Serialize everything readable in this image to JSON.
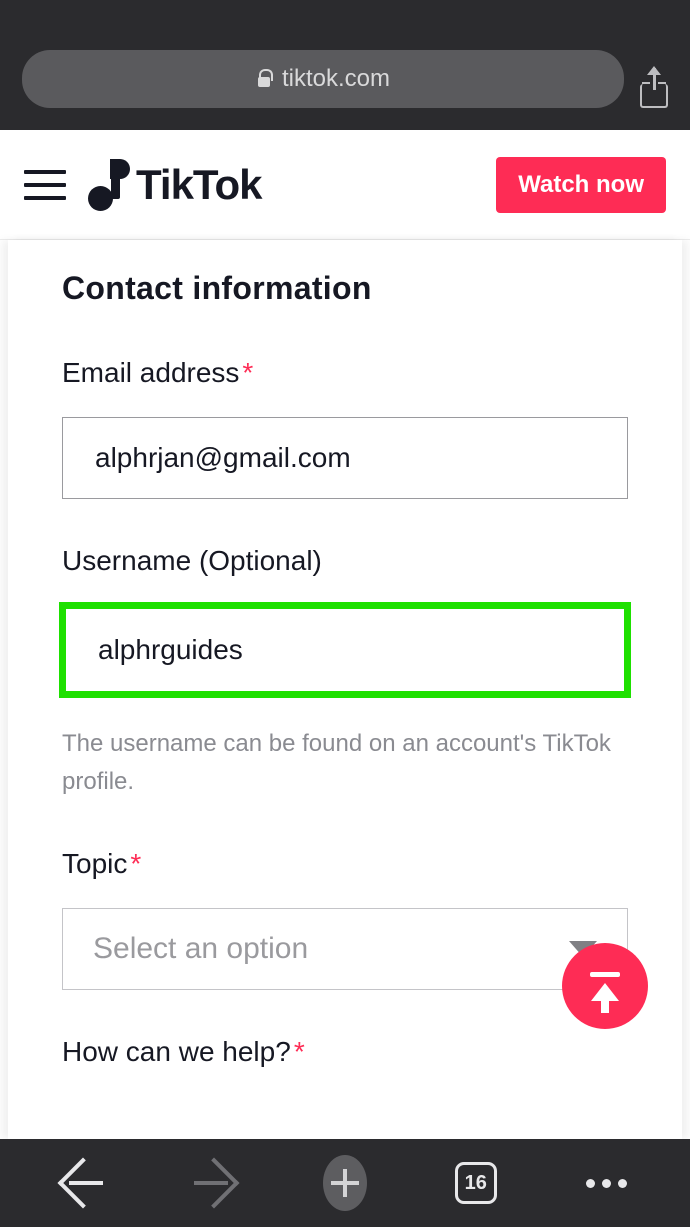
{
  "browser": {
    "url": "tiktok.com",
    "tab_count": "16"
  },
  "header": {
    "brand": "TikTok",
    "watch_now": "Watch now"
  },
  "form": {
    "section_title": "Contact information",
    "email_label": "Email address",
    "email_value": "alphrjan@gmail.com",
    "username_label": "Username (Optional)",
    "username_value": "alphrguides",
    "username_hint": "The username can be found on an account's TikTok profile.",
    "topic_label": "Topic",
    "topic_placeholder": "Select an option",
    "help_label": "How can we help?"
  }
}
